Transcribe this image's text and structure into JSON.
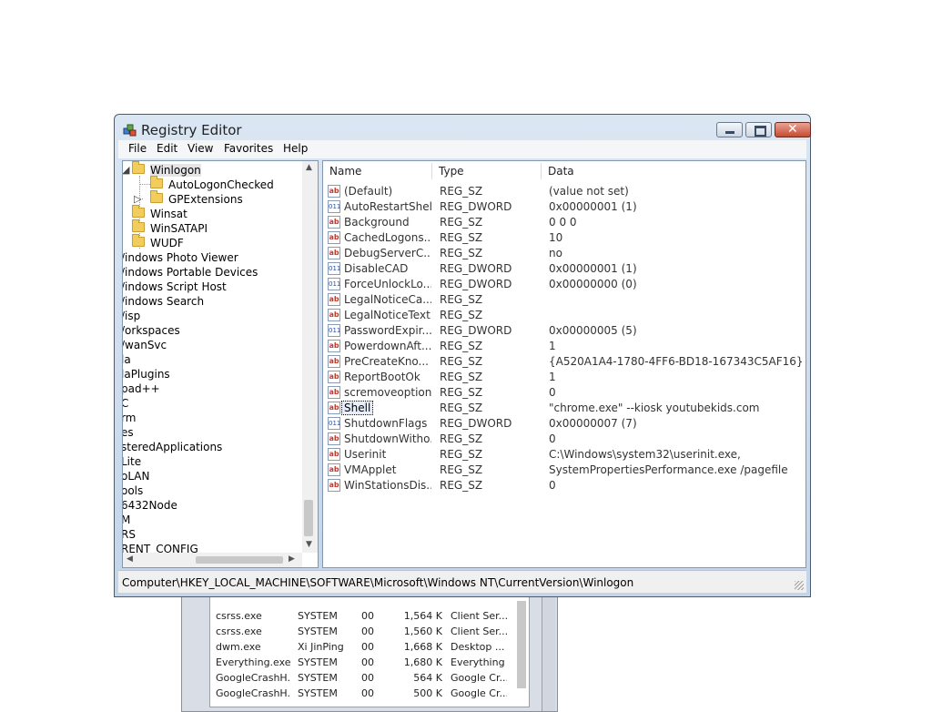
{
  "window": {
    "title": "Registry Editor"
  },
  "menu": [
    "File",
    "Edit",
    "View",
    "Favorites",
    "Help"
  ],
  "tree": {
    "items": [
      {
        "label": "Winlogon",
        "expander": "◢",
        "selected": true
      },
      {
        "label": "AutoLogonChecked"
      },
      {
        "label": "GPExtensions",
        "expander": "▷"
      },
      {
        "label": "Winsat",
        "expander": "▷"
      },
      {
        "label": "WinSATAPI",
        "expander": "▷"
      },
      {
        "label": "WUDF",
        "expander": "▷"
      },
      {
        "label": "/indows Photo Viewer"
      },
      {
        "label": "/indows Portable Devices"
      },
      {
        "label": "/indows Script Host"
      },
      {
        "label": "/indows Search"
      },
      {
        "label": "/isp"
      },
      {
        "label": "/orkspaces"
      },
      {
        "label": "/wanSvc"
      },
      {
        "label": "la"
      },
      {
        "label": "laPlugins"
      },
      {
        "label": "pad++"
      },
      {
        "label": "C"
      },
      {
        "label": "rm"
      },
      {
        "label": "es"
      },
      {
        "label": "steredApplications"
      },
      {
        "label": " Lite"
      },
      {
        "label": "oLAN"
      },
      {
        "label": "ools"
      },
      {
        "label": "6432Node"
      },
      {
        "label": "M"
      },
      {
        "label": "RS"
      },
      {
        "label": "RENT_CONFIG"
      }
    ]
  },
  "list": {
    "headers": {
      "name": "Name",
      "type": "Type",
      "data": "Data"
    },
    "rows": [
      {
        "name": "(Default)",
        "type": "REG_SZ",
        "data": "(value not set)",
        "icon": "ab"
      },
      {
        "name": "AutoRestartShell",
        "type": "REG_DWORD",
        "data": "0x00000001 (1)",
        "icon": "011"
      },
      {
        "name": "Background",
        "type": "REG_SZ",
        "data": "0 0 0",
        "icon": "ab"
      },
      {
        "name": "CachedLogons...",
        "type": "REG_SZ",
        "data": "10",
        "icon": "ab"
      },
      {
        "name": "DebugServerC...",
        "type": "REG_SZ",
        "data": "no",
        "icon": "ab"
      },
      {
        "name": "DisableCAD",
        "type": "REG_DWORD",
        "data": "0x00000001 (1)",
        "icon": "011"
      },
      {
        "name": "ForceUnlockLo...",
        "type": "REG_DWORD",
        "data": "0x00000000 (0)",
        "icon": "011"
      },
      {
        "name": "LegalNoticeCa...",
        "type": "REG_SZ",
        "data": "",
        "icon": "ab"
      },
      {
        "name": "LegalNoticeText",
        "type": "REG_SZ",
        "data": "",
        "icon": "ab"
      },
      {
        "name": "PasswordExpir...",
        "type": "REG_DWORD",
        "data": "0x00000005 (5)",
        "icon": "011"
      },
      {
        "name": "PowerdownAft...",
        "type": "REG_SZ",
        "data": "1",
        "icon": "ab"
      },
      {
        "name": "PreCreateKno...",
        "type": "REG_SZ",
        "data": "{A520A1A4-1780-4FF6-BD18-167343C5AF16}",
        "icon": "ab"
      },
      {
        "name": "ReportBootOk",
        "type": "REG_SZ",
        "data": "1",
        "icon": "ab"
      },
      {
        "name": "scremoveoption",
        "type": "REG_SZ",
        "data": "0",
        "icon": "ab"
      },
      {
        "name": "Shell",
        "type": "REG_SZ",
        "data": "\"chrome.exe\" --kiosk youtubekids.com",
        "icon": "ab",
        "selected": true
      },
      {
        "name": "ShutdownFlags",
        "type": "REG_DWORD",
        "data": "0x00000007 (7)",
        "icon": "011"
      },
      {
        "name": "ShutdownWitho...",
        "type": "REG_SZ",
        "data": "0",
        "icon": "ab"
      },
      {
        "name": "Userinit",
        "type": "REG_SZ",
        "data": "C:\\Windows\\system32\\userinit.exe,",
        "icon": "ab"
      },
      {
        "name": "VMApplet",
        "type": "REG_SZ",
        "data": "SystemPropertiesPerformance.exe /pagefile",
        "icon": "ab"
      },
      {
        "name": "WinStationsDis...",
        "type": "REG_SZ",
        "data": "0",
        "icon": "ab"
      }
    ]
  },
  "status": {
    "path": "Computer\\HKEY_LOCAL_MACHINE\\SOFTWARE\\Microsoft\\Windows NT\\CurrentVersion\\Winlogon"
  },
  "taskmgr": {
    "rows": [
      {
        "image": "csrss.exe",
        "user": "SYSTEM",
        "cpu": "00",
        "mem": "1,564 K",
        "desc": "Client Ser..."
      },
      {
        "image": "csrss.exe",
        "user": "SYSTEM",
        "cpu": "00",
        "mem": "1,560 K",
        "desc": "Client Ser..."
      },
      {
        "image": "dwm.exe",
        "user": "Xi JinPing",
        "cpu": "00",
        "mem": "1,668 K",
        "desc": "Desktop ..."
      },
      {
        "image": "Everything.exe",
        "user": "SYSTEM",
        "cpu": "00",
        "mem": "1,680 K",
        "desc": "Everything"
      },
      {
        "image": "GoogleCrashH...",
        "user": "SYSTEM",
        "cpu": "00",
        "mem": "564 K",
        "desc": "Google Cr..."
      },
      {
        "image": "GoogleCrashH...",
        "user": "SYSTEM",
        "cpu": "00",
        "mem": "500 K",
        "desc": "Google Cr..."
      }
    ]
  }
}
